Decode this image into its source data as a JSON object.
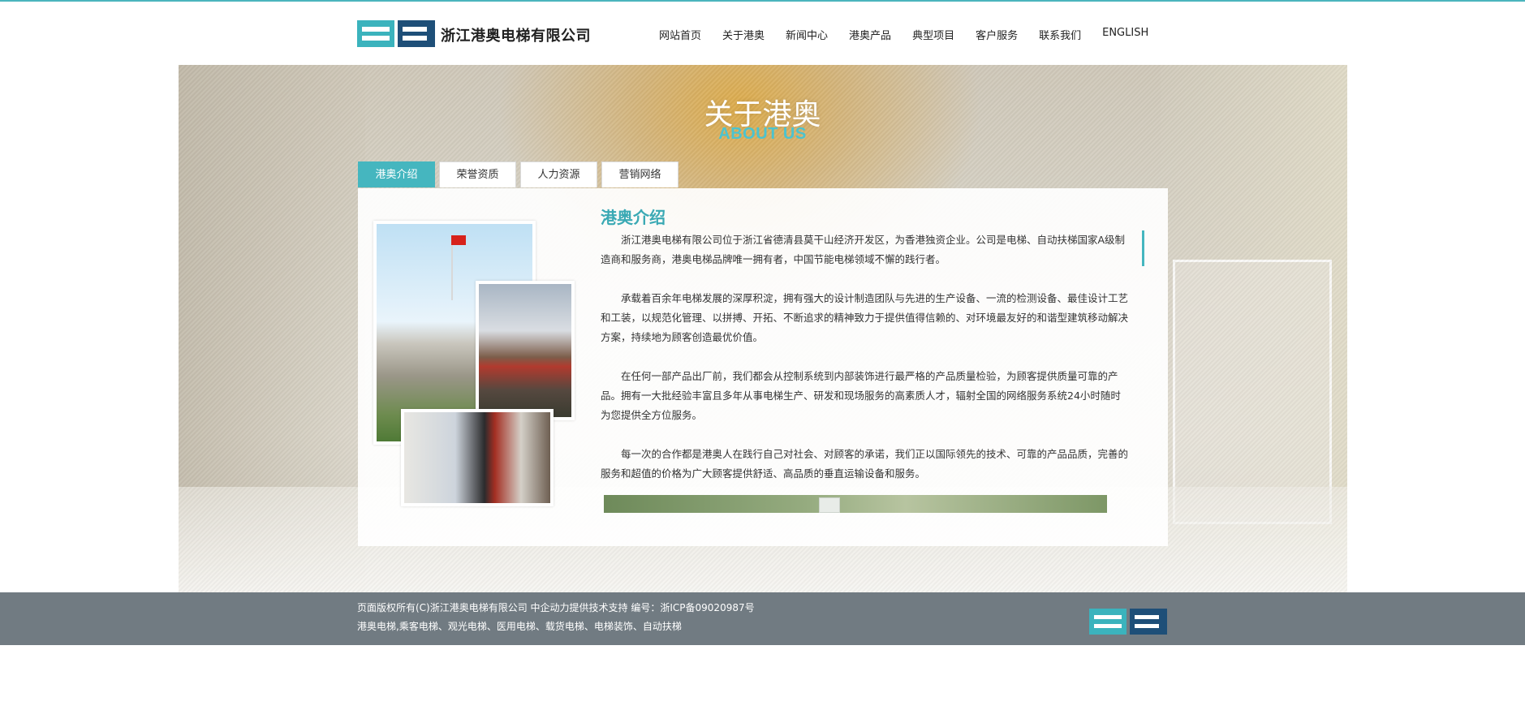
{
  "header": {
    "company_name": "浙江港奥电梯有限公司",
    "nav": [
      "网站首页",
      "关于港奥",
      "新闻中心",
      "港奥产品",
      "典型项目",
      "客户服务",
      "联系我们",
      "ENGLISH"
    ]
  },
  "banner": {
    "title": "关于港奥",
    "subtitle": "ABOUT US"
  },
  "tabs": [
    "港奥介绍",
    "荣誉资质",
    "人力资源",
    "营销网络"
  ],
  "active_tab": 0,
  "content": {
    "title": "港奥介绍",
    "paragraphs": [
      "浙江港奥电梯有限公司位于浙江省德清县莫干山经济开发区，为香港独资企业。公司是电梯、自动扶梯国家A级制造商和服务商，港奥电梯品牌唯一拥有者，中国节能电梯领域不懈的践行者。",
      "承载着百余年电梯发展的深厚积淀，拥有强大的设计制造团队与先进的生产设备、一流的检测设备、最佳设计工艺和工装，以规范化管理、以拼搏、开拓、不断追求的精神致力于提供值得信赖的、对环境最友好的和谐型建筑移动解决方案，持续地为顾客创造最优价值。",
      "在任何一部产品出厂前，我们都会从控制系统到内部装饰进行最严格的产品质量检验，为顾客提供质量可靠的产品。拥有一大批经验丰富且多年从事电梯生产、研发和现场服务的高素质人才，辐射全国的网络服务系统24小时随时为您提供全方位服务。",
      "每一次的合作都是港奥人在践行自己对社会、对顾客的承诺，我们正以国际领先的技术、可靠的产品品质，完善的服务和超值的价格为广大顾客提供舒适、高品质的垂直运输设备和服务。"
    ]
  },
  "footer": {
    "line1": "页面版权所有(C)浙江港奥电梯有限公司      中企动力提供技术支持   编号：浙ICP备09020987号",
    "line2": "港奥电梯,乘客电梯、观光电梯、医用电梯、载货电梯、电梯装饰、自动扶梯"
  },
  "colors": {
    "accent": "#45b6bf",
    "logo_dark": "#1e4f78",
    "footer_bg": "#717b82"
  }
}
